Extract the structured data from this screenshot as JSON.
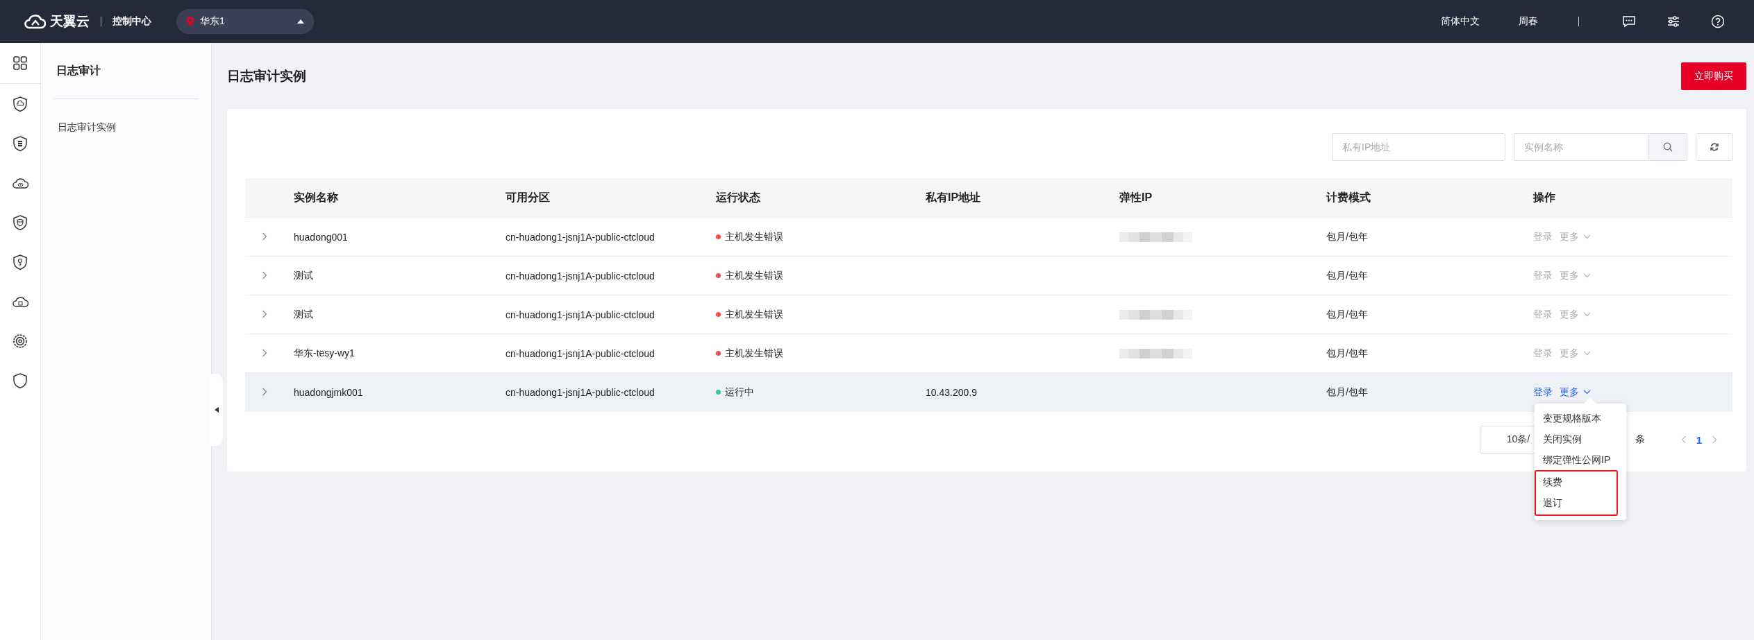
{
  "topbar": {
    "logo_text": "天翼云",
    "console": "控制中心",
    "region": "华东1",
    "language": "简体中文",
    "user": "周春"
  },
  "icon_rail": [
    {
      "kind": "grid"
    },
    {
      "kind": "shield-cloud"
    },
    {
      "kind": "shield-server"
    },
    {
      "kind": "cloud-eye"
    },
    {
      "kind": "shield-shield"
    },
    {
      "kind": "shield-key"
    },
    {
      "kind": "cloud-box"
    },
    {
      "kind": "gear"
    },
    {
      "kind": "shield"
    }
  ],
  "sidebar": {
    "title": "日志审计",
    "items": [
      {
        "label": "日志审计实例",
        "selected": false
      }
    ]
  },
  "page": {
    "title": "日志审计实例",
    "buy_button": "立即购买"
  },
  "filters": [
    {
      "placeholder": "私有IP地址",
      "kind": "text"
    },
    {
      "placeholder": "实例名称",
      "kind": "search"
    }
  ],
  "table": {
    "columns": [
      "实例名称",
      "可用分区",
      "运行状态",
      "私有IP地址",
      "弹性IP",
      "计费模式",
      "操作"
    ],
    "rows": [
      {
        "name": "huadong001",
        "zone": "cn-huadong1-jsnj1A-public-ctcloud",
        "status": "主机发生错误",
        "color": "#f5484a",
        "elastic_ip_blurred": true,
        "billing": "包月/包年",
        "actions": [
          "登录",
          "更多"
        ],
        "actions_enabled": false,
        "highlighted": false
      },
      {
        "name": "测试",
        "zone": "cn-huadong1-jsnj1A-public-ctcloud",
        "status": "主机发生错误",
        "color": "#f5484a",
        "elastic_ip_blurred": false,
        "billing": "包月/包年",
        "actions": [
          "登录",
          "更多"
        ],
        "actions_enabled": false,
        "highlighted": false
      },
      {
        "name": "测试",
        "zone": "cn-huadong1-jsnj1A-public-ctcloud",
        "status": "主机发生错误",
        "color": "#f5484a",
        "elastic_ip_blurred": true,
        "billing": "包月/包年",
        "actions": [
          "登录",
          "更多"
        ],
        "actions_enabled": false,
        "highlighted": false
      },
      {
        "name": "华东-tesy-wy1",
        "zone": "cn-huadong1-jsnj1A-public-ctcloud",
        "status": "主机发生错误",
        "color": "#f5484a",
        "elastic_ip_blurred": true,
        "billing": "包月/包年",
        "actions": [
          "登录",
          "更多"
        ],
        "actions_enabled": false,
        "highlighted": false
      },
      {
        "name": "huadongjmk001",
        "zone": "cn-huadong1-jsnj1A-public-ctcloud",
        "status": "运行中",
        "color": "#2fcf8a",
        "private_ip": "10.43.200.9",
        "elastic_ip_blurred": false,
        "billing": "包月/包年",
        "actions": [
          "登录",
          "更多"
        ],
        "actions_enabled": true,
        "highlighted": true
      }
    ]
  },
  "dropdown": {
    "items": [
      {
        "label": "变更规格版本",
        "annotated": false
      },
      {
        "label": "关闭实例",
        "annotated": false
      },
      {
        "label": "绑定弹性公网IP",
        "annotated": false
      },
      {
        "label": "续费",
        "annotated": true
      },
      {
        "label": "退订",
        "annotated": true
      }
    ]
  },
  "pagination": {
    "page_size": "10条/",
    "total": "条",
    "pages": [
      {
        "label": "1",
        "selected": true
      }
    ]
  }
}
